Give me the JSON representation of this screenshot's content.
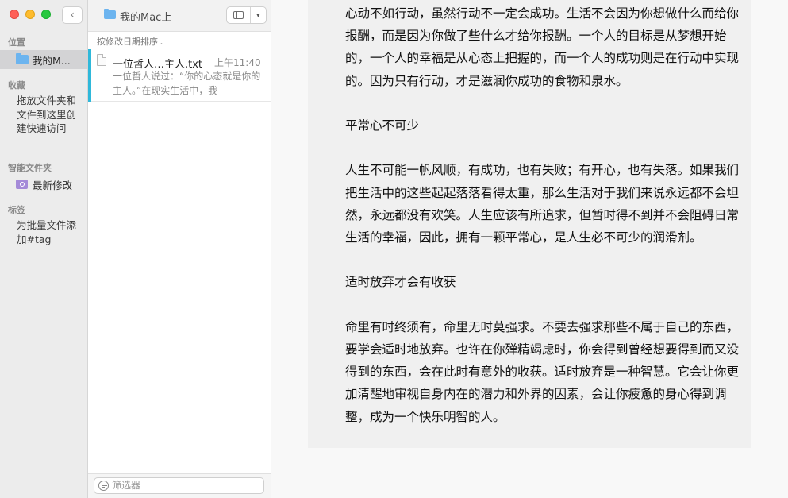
{
  "window": {
    "title": "我的Mac上"
  },
  "sidebar": {
    "sections": {
      "location": "位置",
      "favorites": "收藏",
      "smart_folders": "智能文件夹",
      "tags": "标签"
    },
    "location_item": "我的M...",
    "favorites_hint": "拖放文件夹和文件到这里创建快速访问",
    "smart_item": "最新修改",
    "tags_hint": "为批量文件添加#tag"
  },
  "list": {
    "sort_label": "按修改日期排序",
    "notes": [
      {
        "name": "一位哲人…主人.txt",
        "time": "上午11:40",
        "preview": "一位哲人说过：“你的心态就是你的主人。”在现实生活中，我"
      }
    ],
    "filter_placeholder": "筛选器"
  },
  "article": {
    "paragraphs": [
      "心动不如行动，虽然行动不一定会成功。生活不会因为你想做什么而给你报酬，而是因为你做了些什么才给你报酬。一个人的目标是从梦想开始的，一个人的幸福是从心态上把握的，而一个人的成功则是在行动中实现的。因为只有行动，才是滋润你成功的食物和泉水。",
      "平常心不可少",
      "人生不可能一帆风顺，有成功，也有失败；有开心，也有失落。如果我们把生活中的这些起起落落看得太重，那么生活对于我们来说永远都不会坦然，永远都没有欢笑。人生应该有所追求，但暂时得不到并不会阻碍日常生活的幸福，因此，拥有一颗平常心，是人生必不可少的润滑剂。",
      "适时放弃才会有收获",
      "命里有时终须有，命里无时莫强求。不要去强求那些不属于自己的东西，要学会适时地放弃。也许在你殚精竭虑时，你会得到曾经想要得到而又没得到的东西，会在此时有意外的收获。适时放弃是一种智慧。它会让你更加清醒地审视自身内在的潜力和外界的因素，会让你疲惫的身心得到调整，成为一个快乐明智的人。"
    ]
  },
  "icons": {
    "back": "chevron-left-icon",
    "sidebar_toggle": "sidebar-toggle-icon",
    "folder": "folder-icon",
    "smart_folder": "smart-folder-icon",
    "document": "document-icon",
    "filter": "filter-icon"
  },
  "colors": {
    "selection_accent": "#2fb8da",
    "folder_blue": "#6cb4ef",
    "smart_purple": "#a48ad8"
  }
}
